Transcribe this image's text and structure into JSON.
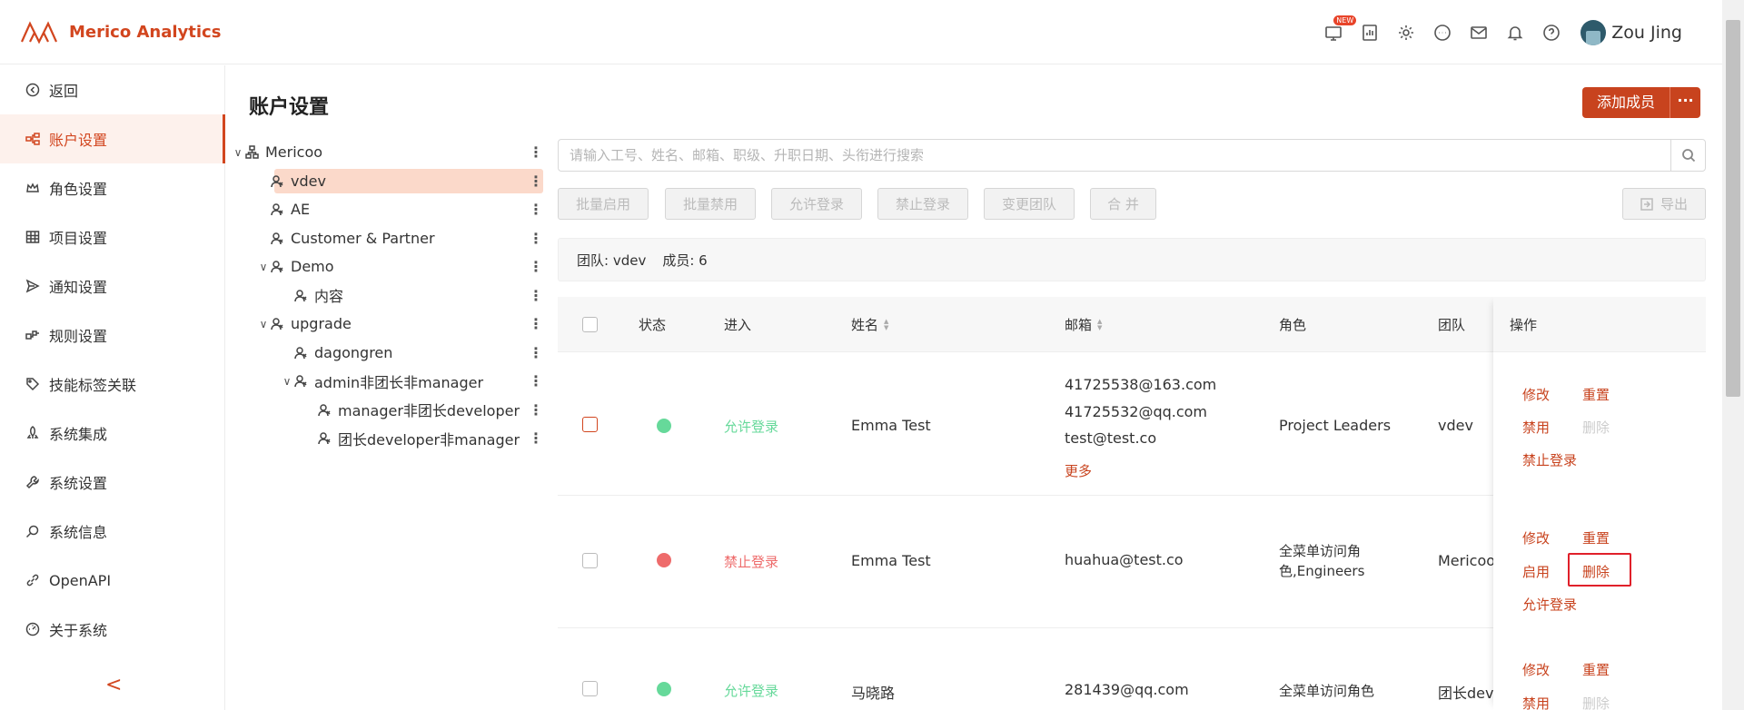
{
  "app": {
    "name": "Merico Analytics",
    "user": "Zou Jing",
    "new_badge": "NEW"
  },
  "sidebar": {
    "items": [
      {
        "label": "返回",
        "icon": "back-circle-icon",
        "active": false
      },
      {
        "label": "账户设置",
        "icon": "org-icon",
        "active": true
      },
      {
        "label": "角色设置",
        "icon": "crown-icon",
        "active": false
      },
      {
        "label": "项目设置",
        "icon": "grid-icon",
        "active": false
      },
      {
        "label": "通知设置",
        "icon": "send-icon",
        "active": false
      },
      {
        "label": "规则设置",
        "icon": "rules-icon",
        "active": false
      },
      {
        "label": "技能标签关联",
        "icon": "tag-icon",
        "active": false
      },
      {
        "label": "系统集成",
        "icon": "rocket-icon",
        "active": false
      },
      {
        "label": "系统设置",
        "icon": "wrench-icon",
        "active": false
      },
      {
        "label": "系统信息",
        "icon": "search-person-icon",
        "active": false
      },
      {
        "label": "OpenAPI",
        "icon": "link-icon",
        "active": false
      },
      {
        "label": "关于系统",
        "icon": "dashboard-icon",
        "active": false
      }
    ],
    "collapse": "<"
  },
  "page": {
    "title": "账户设置",
    "add_member": "添加成员",
    "more": "···"
  },
  "tree": [
    {
      "label": "Mericoo",
      "level": 0,
      "caret": "∨",
      "icon": "org"
    },
    {
      "label": "vdev",
      "level": 1,
      "caret": "",
      "icon": "team",
      "selected": true
    },
    {
      "label": "AE",
      "level": 1,
      "caret": "",
      "icon": "team"
    },
    {
      "label": "Customer & Partner",
      "level": 1,
      "caret": "",
      "icon": "team"
    },
    {
      "label": "Demo",
      "level": 1,
      "caret": "∨",
      "icon": "team"
    },
    {
      "label": "内容",
      "level": 2,
      "caret": "",
      "icon": "team"
    },
    {
      "label": "upgrade",
      "level": 1,
      "caret": "∨",
      "icon": "team"
    },
    {
      "label": "dagongren",
      "level": 2,
      "caret": "",
      "icon": "team"
    },
    {
      "label": "admin非团长非manager",
      "level": 2,
      "caret": "∨",
      "icon": "team"
    },
    {
      "label": "manager非团长developer",
      "level": 3,
      "caret": "",
      "icon": "team"
    },
    {
      "label": "团长developer非manager",
      "level": 3,
      "caret": "",
      "icon": "team"
    }
  ],
  "search": {
    "placeholder": "请输入工号、姓名、邮箱、职级、升职日期、头衔进行搜索"
  },
  "toolbar": {
    "buttons": [
      "批量启用",
      "批量禁用",
      "允许登录",
      "禁止登录",
      "变更团队",
      "合 并"
    ],
    "export": "导出"
  },
  "info": {
    "team": "团队: vdev",
    "members": "成员: 6"
  },
  "table": {
    "headers": {
      "status": "状态",
      "login": "进入",
      "name": "姓名",
      "email": "邮箱",
      "role": "角色",
      "team": "团队",
      "ops": "操作"
    },
    "rows": [
      {
        "status_color": "#66d99a",
        "login": "允许登录",
        "login_color": "green",
        "name": "Emma Test",
        "emails": [
          "41725538@163.com",
          "41725532@qq.com",
          "test@test.co"
        ],
        "more": "更多",
        "role": "Project Leaders",
        "team": "vdev",
        "ops": {
          "edit": "修改",
          "reset": "重置",
          "toggle": "禁用",
          "delete": "删除",
          "login_toggle": "禁止登录"
        }
      },
      {
        "status_color": "#ee6b6b",
        "login": "禁止登录",
        "login_color": "red",
        "name": "Emma Test",
        "emails": [
          "huahua@test.co"
        ],
        "role_line1": "全菜单访问角",
        "role_line2": "色,Engineers",
        "team": "Mericoo",
        "ops": {
          "edit": "修改",
          "reset": "重置",
          "toggle": "启用",
          "delete": "删除",
          "login_toggle": "允许登录"
        }
      },
      {
        "status_color": "#66d99a",
        "login": "允许登录",
        "login_color": "green",
        "name": "马晓路",
        "emails": [
          "281439@qq.com"
        ],
        "role": "全菜单访问角色",
        "team": "团长dev",
        "ops": {
          "edit": "修改",
          "reset": "重置",
          "toggle": "禁用",
          "delete": "删除"
        }
      }
    ]
  },
  "colors": {
    "brand": "#c8431e",
    "active_bg": "#fdf1ec",
    "selected_tree": "#fbd9ca",
    "green": "#66d99a",
    "red": "#ee6b6b",
    "highlight": "#e0202a"
  }
}
